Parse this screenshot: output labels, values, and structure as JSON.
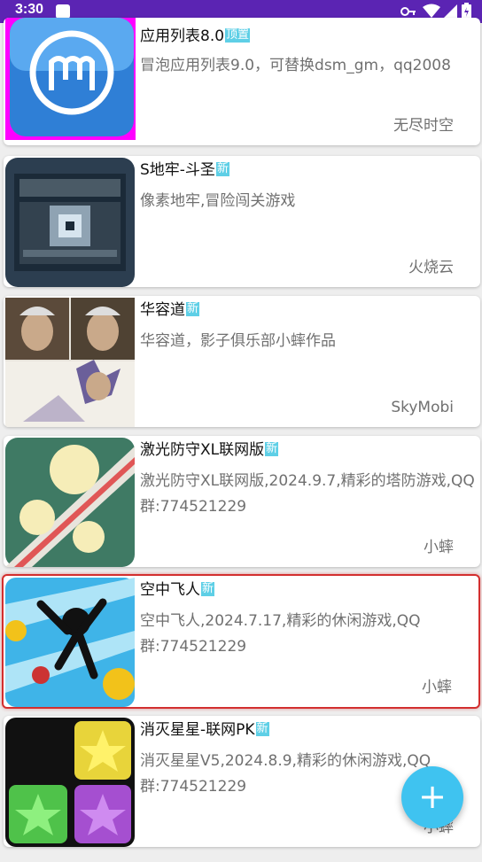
{
  "status_bar": {
    "time": "3:30",
    "bg": "#5b24b3"
  },
  "apps": [
    {
      "title": "应用列表8.0",
      "badge": "顶置",
      "desc": "冒泡应用列表9.0，可替换dsm_gm，qq2008",
      "author": "无尽时空",
      "icon": "app-list-icon"
    },
    {
      "title": "S地牢-斗圣",
      "badge": "新",
      "desc": "像素地牢,冒险闯关游戏",
      "author": "火烧云",
      "icon": "dungeon-chest-icon"
    },
    {
      "title": "华容道",
      "badge": "新",
      "desc": "华容道，影子俱乐部小蟀作品",
      "author": "SkyMobi",
      "icon": "huarongdao-icon"
    },
    {
      "title": "激光防守XL联网版",
      "badge": "新",
      "desc": "激光防守XL联网版,2024.9.7,精彩的塔防游戏,QQ群:774521229",
      "author": "小蟀",
      "icon": "laser-defense-icon"
    },
    {
      "title": "空中飞人",
      "badge": "新",
      "desc": "空中飞人,2024.7.17,精彩的休闲游戏,QQ群:774521229",
      "author": "小蟀",
      "icon": "sky-flyer-icon"
    },
    {
      "title": "消灭星星-联网PK",
      "badge": "新",
      "desc": "消灭星星V5,2024.8.9,精彩的休闲游戏,QQ群:774521229",
      "author": "小蟀",
      "icon": "pop-star-icon"
    }
  ],
  "fab": {
    "label": "+"
  },
  "colors": {
    "badge": "#5ecfe6",
    "selected_border": "#d32f2f",
    "fab": "#3fc3f0"
  }
}
